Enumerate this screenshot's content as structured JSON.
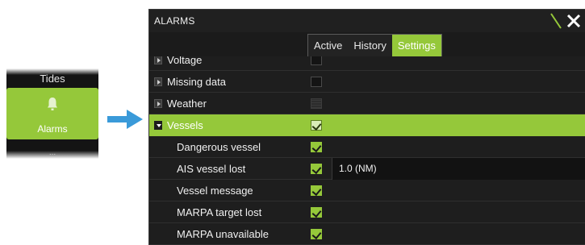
{
  "mini_menu": {
    "items": [
      {
        "label": "Tides"
      },
      {
        "label": "Alarms",
        "selected": true,
        "icon": "bell-icon"
      },
      {
        "label": "..."
      }
    ]
  },
  "arrow": {
    "icon": "arrow-right-icon",
    "color": "#3a9ad9"
  },
  "dialog": {
    "title": "ALARMS",
    "tabs": [
      {
        "label": "Active"
      },
      {
        "label": "History"
      },
      {
        "label": "Settings",
        "active": true
      }
    ],
    "rows": [
      {
        "label": "Voltage",
        "checked": false,
        "expandable": true
      },
      {
        "label": "Missing data",
        "checked": false,
        "expandable": true
      },
      {
        "label": "Weather",
        "checked": false,
        "disabled": true,
        "expandable": true
      },
      {
        "label": "Vessels",
        "checked": true,
        "expanded": true,
        "selected": true
      },
      {
        "label": "Dangerous vessel",
        "checked": true
      },
      {
        "label": "AIS vessel lost",
        "checked": true,
        "value": "1.0 (NM)"
      },
      {
        "label": "Vessel message",
        "checked": true
      },
      {
        "label": "MARPA target lost",
        "checked": true
      },
      {
        "label": "MARPA unavailable",
        "checked": true
      }
    ]
  },
  "colors": {
    "accent": "#95c83a",
    "background": "#1d1d1d",
    "arrow": "#3a9ad9"
  }
}
